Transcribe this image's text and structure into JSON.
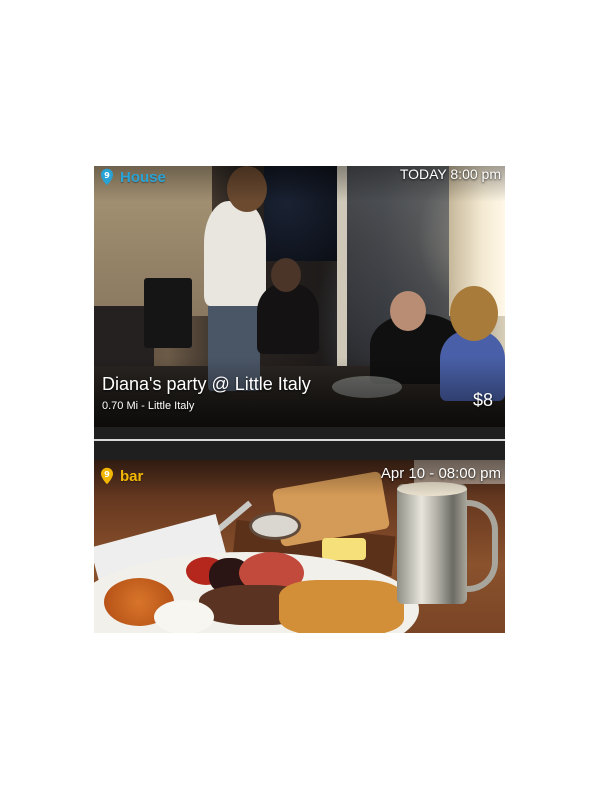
{
  "events": [
    {
      "category": "House",
      "category_color": "#29a3d6",
      "category_icon": "map-pin-icon",
      "when": "TODAY 8:00 pm",
      "title": "Diana's party @ Little Italy",
      "subtitle": "0.70 Mi - Little Italy",
      "price": "$8",
      "photo": "party-photo"
    },
    {
      "category": "bar",
      "category_color": "#f2b705",
      "category_icon": "map-pin-icon",
      "when": "Apr 10 - 08:00 pm",
      "photo": "food-photo"
    }
  ]
}
